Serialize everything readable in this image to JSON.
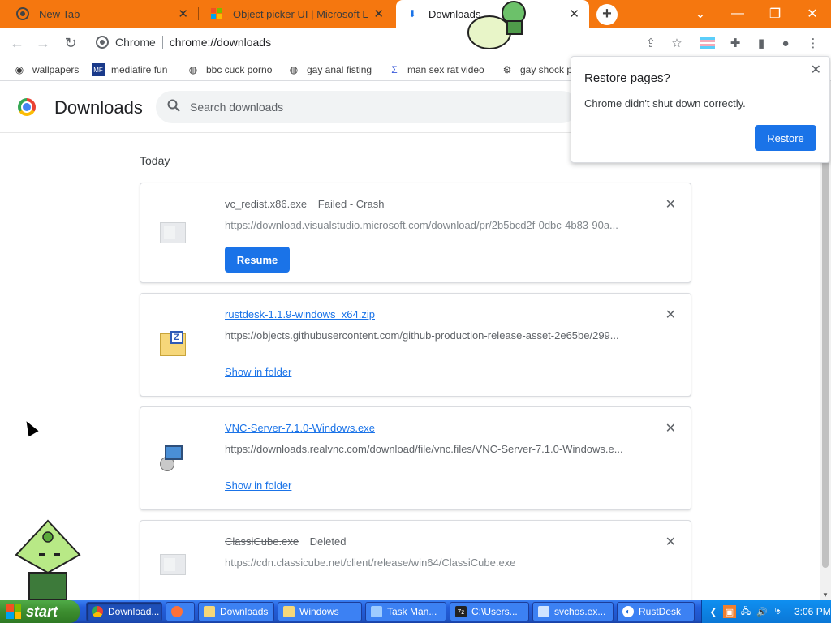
{
  "tabs": [
    {
      "title": "New Tab",
      "active": false
    },
    {
      "title": "Object picker UI | Microsoft L",
      "active": false
    },
    {
      "title": "Downloads",
      "active": true
    }
  ],
  "toolbar": {
    "site_label": "Chrome",
    "url": "chrome://downloads"
  },
  "bookmarks": [
    "wallpapers",
    "mediafire fun",
    "bbc cuck porno",
    "gay anal fisting",
    "man sex rat video",
    "gay shock p"
  ],
  "downloads_page": {
    "title": "Downloads",
    "search_placeholder": "Search downloads",
    "section_label": "Today",
    "items": [
      {
        "filename": "vc_redist.x86.exe",
        "status": "Failed - Crash",
        "url": "https://download.visualstudio.microsoft.com/download/pr/2b5bcd2f-0dbc-4b83-90a...",
        "action": "Resume",
        "icon": "generic-file-icon"
      },
      {
        "filename": "rustdesk-1.1.9-windows_x64.zip",
        "status": "",
        "url": "https://objects.githubusercontent.com/github-production-release-asset-2e65be/299...",
        "action": "Show in folder",
        "icon": "zip-icon"
      },
      {
        "filename": "VNC-Server-7.1.0-Windows.exe",
        "status": "",
        "url": "https://downloads.realvnc.com/download/file/vnc.files/VNC-Server-7.1.0-Windows.e...",
        "action": "Show in folder",
        "icon": "installer-icon"
      },
      {
        "filename": "ClassiCube.exe",
        "status": "Deleted",
        "url": "https://cdn.classicube.net/client/release/win64/ClassiCube.exe",
        "action": "",
        "icon": "generic-file-icon"
      }
    ]
  },
  "popup": {
    "title": "Restore pages?",
    "body": "Chrome didn't shut down correctly.",
    "button": "Restore"
  },
  "taskbar": {
    "start_label": "start",
    "buttons": [
      "Download...",
      "",
      "Downloads",
      "Windows",
      "Task Man...",
      "C:\\Users...",
      "svchos.ex...",
      "RustDesk"
    ],
    "clock": "3:06 PM"
  },
  "colors": {
    "tabbar": "#f5770f",
    "accent": "#1a73e8",
    "taskbar": "#245edb",
    "start": "#3c8d2f"
  }
}
